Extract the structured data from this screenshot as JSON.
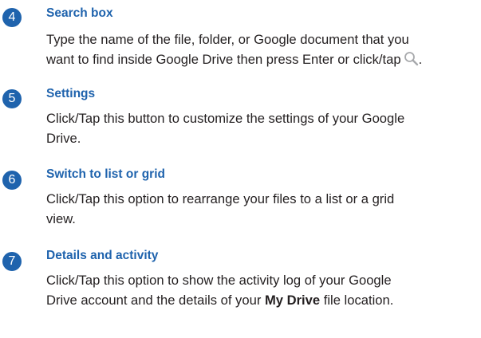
{
  "items": [
    {
      "number": "4",
      "title": "Search box",
      "lines": [
        "Type the name of the file, folder, or Google document that you",
        "want to find inside Google Drive then press Enter or click/tap",
        "."
      ],
      "inline_icon": "search-icon"
    },
    {
      "number": "5",
      "title": "Settings",
      "lines": [
        "Click/Tap this button to customize the settings of your Google",
        "Drive."
      ]
    },
    {
      "number": "6",
      "title": "Switch to list or grid",
      "lines": [
        "Click/Tap this option to rearrange your files to a list or a grid",
        "view."
      ]
    },
    {
      "number": "7",
      "title": "Details and activity",
      "lines": [
        "Click/Tap this option to show the activity log of your Google",
        "Drive account and the details of your ",
        "My Drive",
        " file location."
      ]
    }
  ],
  "colors": {
    "accent": "#1f63ad",
    "text": "#231f20",
    "icon": "#a7a9ac"
  }
}
